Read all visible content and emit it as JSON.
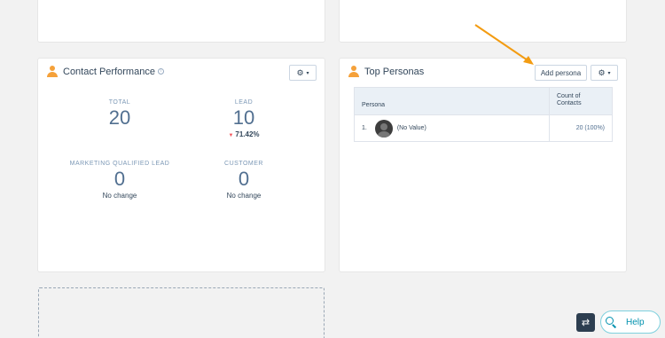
{
  "contact_performance": {
    "title": "Contact Performance",
    "info_icon": "i",
    "metrics": [
      {
        "label": "TOTAL",
        "value": "20",
        "change": ""
      },
      {
        "label": "LEAD",
        "value": "10",
        "change": "71.42%"
      },
      {
        "label": "MARKETING QUALIFIED LEAD",
        "value": "0",
        "change": "No change"
      },
      {
        "label": "CUSTOMER",
        "value": "0",
        "change": "No change"
      }
    ],
    "gear_label": "⚙",
    "caret": "▾"
  },
  "top_personas": {
    "title": "Top Personas",
    "add_button": "Add persona",
    "gear_label": "⚙",
    "caret": "▾",
    "table": {
      "headers": {
        "persona": "Persona",
        "count": "Count of Contacts"
      },
      "rows": [
        {
          "rank": "1.",
          "name": "(No Value)",
          "count": "20 (100%)"
        }
      ]
    }
  },
  "colors": {
    "accent_orange": "#f5a13a",
    "arrow": "#f39c12",
    "down": "#f2545b",
    "help": "#0091ae"
  },
  "footer": {
    "switch_icon": "⇄",
    "help_label": "Help"
  }
}
